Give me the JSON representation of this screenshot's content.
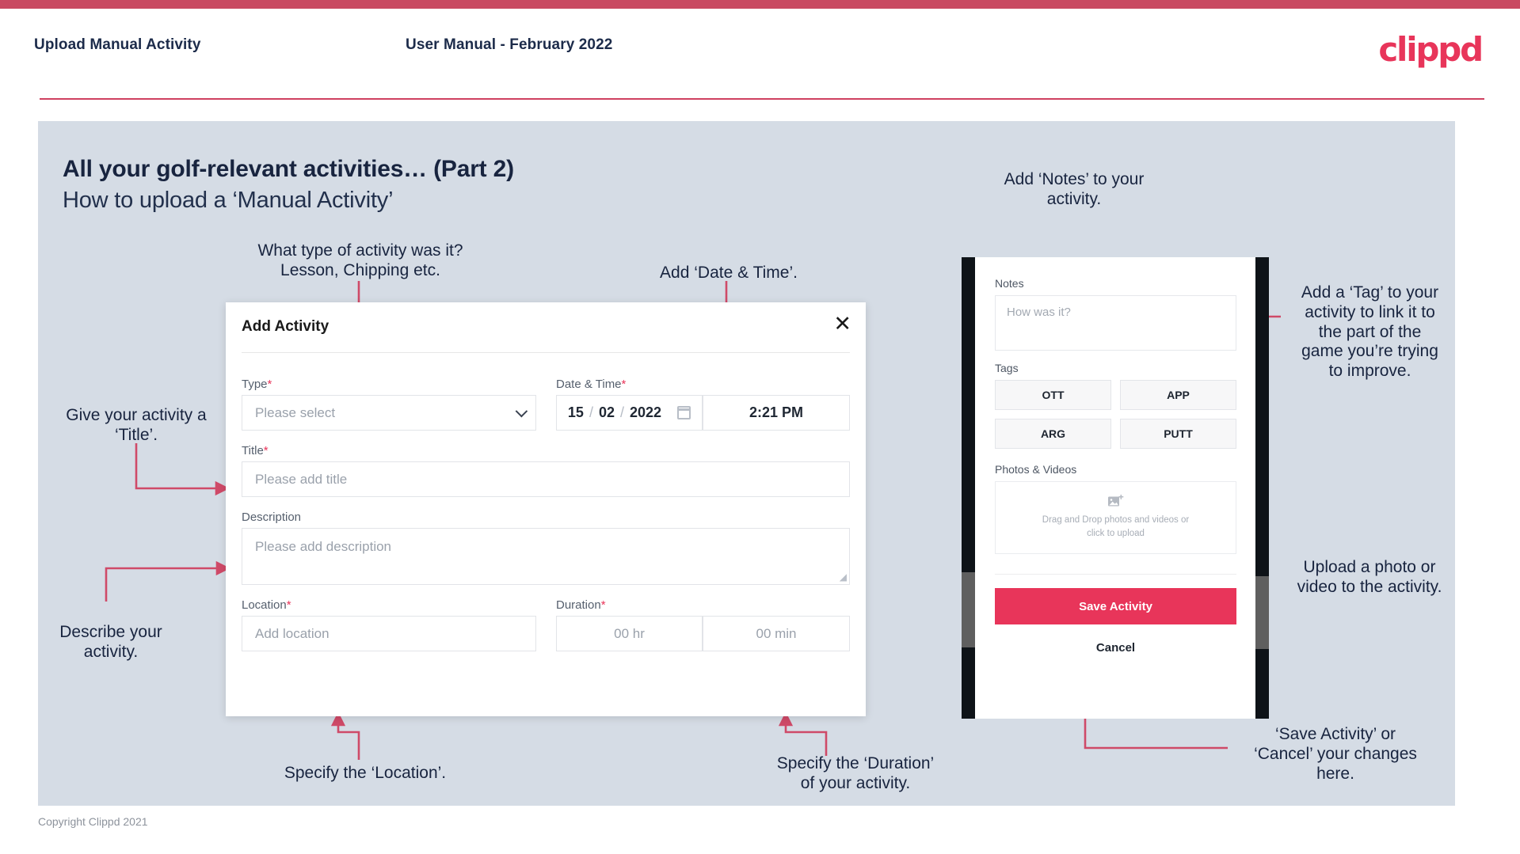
{
  "header": {
    "left_title": "Upload Manual Activity",
    "center_title": "User Manual - February 2022",
    "logo": "clippd"
  },
  "slide": {
    "title_main": "All your golf-relevant activities… (Part 2)",
    "title_sub": "How to upload a ‘Manual Activity’"
  },
  "annotations": {
    "type": "What type of activity was it?\nLesson, Chipping etc.",
    "datetime": "Add ‘Date & Time’.",
    "title": "Give your activity a\n‘Title’.",
    "description": "Describe your\nactivity.",
    "location": "Specify the ‘Location’.",
    "duration": "Specify the ‘Duration’\nof your activity.",
    "notes": "Add ‘Notes’ to your\nactivity.",
    "tags": "Add a ‘Tag’ to your\nactivity to link it to\nthe part of the\ngame you’re trying\nto improve.",
    "upload": "Upload a photo or\nvideo to the activity.",
    "save_cancel": "‘Save Activity’ or\n‘Cancel’ your changes\nhere."
  },
  "dialog": {
    "title": "Add Activity",
    "close_icon": "✕",
    "fields": {
      "type": {
        "label": "Type",
        "required": "*",
        "placeholder": "Please select"
      },
      "datetime": {
        "label": "Date & Time",
        "required": "*",
        "day": "15",
        "month": "02",
        "year": "2022",
        "sep": "/",
        "time": "2:21 PM"
      },
      "title": {
        "label": "Title",
        "required": "*",
        "placeholder": "Please add title"
      },
      "description": {
        "label": "Description",
        "required": "",
        "placeholder": "Please add description"
      },
      "location": {
        "label": "Location",
        "required": "*",
        "placeholder": "Add location"
      },
      "duration": {
        "label": "Duration",
        "required": "*",
        "hours": "00 hr",
        "minutes": "00 min"
      }
    }
  },
  "phone": {
    "notes": {
      "label": "Notes",
      "placeholder": "How was it?"
    },
    "tags": {
      "label": "Tags",
      "options": [
        "OTT",
        "APP",
        "ARG",
        "PUTT"
      ]
    },
    "photos": {
      "label": "Photos & Videos",
      "dropzone_line1": "Drag and Drop photos and videos or",
      "dropzone_line2": "click to upload",
      "icon": "add-image-icon"
    },
    "save_label": "Save Activity",
    "cancel_label": "Cancel"
  },
  "footer": "Copyright Clippd 2021",
  "colors": {
    "brand_pink": "#e8355a",
    "top_bar": "#c94a62",
    "connector": "#cf4a68",
    "slide_bg": "#d5dce5",
    "text_dark": "#18243f"
  }
}
